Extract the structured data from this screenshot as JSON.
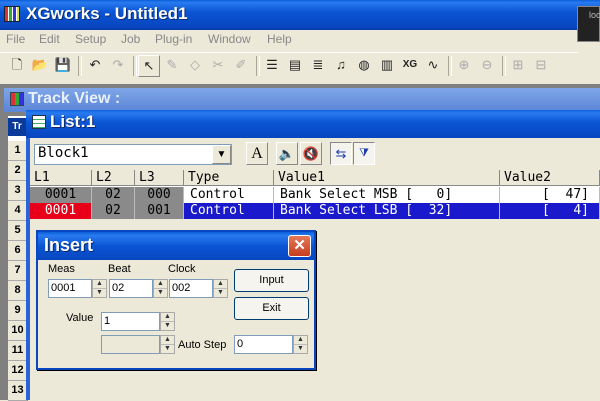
{
  "app": {
    "title": "XGworks - Untitled1",
    "meter_text": "loo"
  },
  "menu": [
    "File",
    "Edit",
    "Setup",
    "Job",
    "Plug-in",
    "Window",
    "Help"
  ],
  "toolbar_icons": [
    "new-file-icon",
    "open-folder-icon",
    "save-icon",
    "undo-icon",
    "redo-icon",
    "pointer-icon",
    "pencil-icon",
    "eraser-icon",
    "scissors-icon",
    "brush-icon",
    "track-view-icon",
    "piano-roll-icon",
    "list-icon",
    "score-icon",
    "drum-icon",
    "mixer-icon",
    "xg-editor-icon",
    "wave-icon",
    "zoom-in-icon",
    "zoom-out-icon",
    "zoom-h-in-icon",
    "zoom-h-out-icon"
  ],
  "track_view": {
    "title": "Track View :",
    "corner": "Tr",
    "rows": [
      "1",
      "2",
      "3",
      "4",
      "5",
      "6",
      "7",
      "8",
      "9",
      "10",
      "11",
      "12",
      "13"
    ]
  },
  "list_window": {
    "title": "List:1",
    "block": "Block1",
    "font_button": "A",
    "columns": [
      "L1",
      "L2",
      "L3",
      "Type",
      "Value1",
      "Value2"
    ],
    "rows": [
      {
        "l1": "0001",
        "l2": "02",
        "l3": "000",
        "type": "Control",
        "value1": "Bank Select MSB [   0]",
        "value2": "[  47]"
      },
      {
        "l1": "0001",
        "l2": "02",
        "l3": "001",
        "type": "Control",
        "value1": "Bank Select LSB [  32]",
        "value2": "[   4]"
      }
    ]
  },
  "insert_dialog": {
    "title": "Insert",
    "close": "✕",
    "meas_label": "Meas",
    "beat_label": "Beat",
    "clock_label": "Clock",
    "meas": "0001",
    "beat": "02",
    "clock": "002",
    "value_label": "Value",
    "value": "1",
    "auto_step_label": "Auto Step",
    "auto_step": "0",
    "input_button": "Input",
    "exit_button": "Exit"
  }
}
